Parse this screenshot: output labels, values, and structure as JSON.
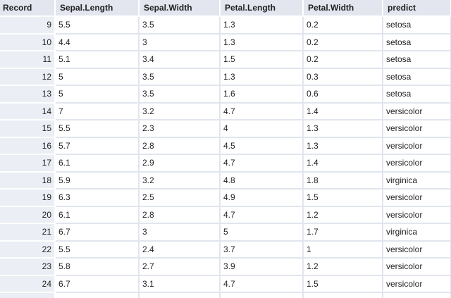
{
  "columns": [
    "Record",
    "Sepal.Length",
    "Sepal.Width",
    "Petal.Length",
    "Petal.Width",
    "predict"
  ],
  "rows": [
    [
      "9",
      "5.5",
      "3.5",
      "1.3",
      "0.2",
      "setosa"
    ],
    [
      "10",
      "4.4",
      "3",
      "1.3",
      "0.2",
      "setosa"
    ],
    [
      "11",
      "5.1",
      "3.4",
      "1.5",
      "0.2",
      "setosa"
    ],
    [
      "12",
      "5",
      "3.5",
      "1.3",
      "0.3",
      "setosa"
    ],
    [
      "13",
      "5",
      "3.5",
      "1.6",
      "0.6",
      "setosa"
    ],
    [
      "14",
      "7",
      "3.2",
      "4.7",
      "1.4",
      "versicolor"
    ],
    [
      "15",
      "5.5",
      "2.3",
      "4",
      "1.3",
      "versicolor"
    ],
    [
      "16",
      "5.7",
      "2.8",
      "4.5",
      "1.3",
      "versicolor"
    ],
    [
      "17",
      "6.1",
      "2.9",
      "4.7",
      "1.4",
      "versicolor"
    ],
    [
      "18",
      "5.9",
      "3.2",
      "4.8",
      "1.8",
      "virginica"
    ],
    [
      "19",
      "6.3",
      "2.5",
      "4.9",
      "1.5",
      "versicolor"
    ],
    [
      "20",
      "6.1",
      "2.8",
      "4.7",
      "1.2",
      "versicolor"
    ],
    [
      "21",
      "6.7",
      "3",
      "5",
      "1.7",
      "virginica"
    ],
    [
      "22",
      "5.5",
      "2.4",
      "3.7",
      "1",
      "versicolor"
    ],
    [
      "23",
      "5.8",
      "2.7",
      "3.9",
      "1.2",
      "versicolor"
    ],
    [
      "24",
      "6.7",
      "3.1",
      "4.7",
      "1.5",
      "versicolor"
    ]
  ]
}
